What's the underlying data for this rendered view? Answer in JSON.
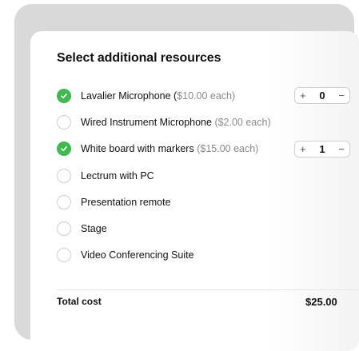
{
  "panel": {
    "title": "Select additional resources"
  },
  "resources": [
    {
      "name": "Lavalier Microphone",
      "paren_open": " (",
      "price": "$10.00 each",
      "paren_close": ")",
      "checked": true,
      "quantity": "0",
      "plus": "+",
      "minus": "−"
    },
    {
      "name": "Wired Instrument Microphone",
      "price": "($2.00 each)",
      "checked": false
    },
    {
      "name": "White board with markers",
      "price": "($15.00 each)",
      "checked": true,
      "quantity": "1",
      "plus": "+",
      "minus": "−"
    },
    {
      "name": "Lectrum with PC",
      "checked": false
    },
    {
      "name": "Presentation remote",
      "checked": false
    },
    {
      "name": "Stage",
      "checked": false
    },
    {
      "name": "Video Conferencing Suite",
      "checked": false
    }
  ],
  "summary": {
    "total_label": "Total cost",
    "total_value": "$25.00"
  },
  "colors": {
    "check_on": "#3fb950",
    "check_off_border": "#cfcfcf",
    "price_text": "#8a8a8a",
    "frame_bg": "#d9d9d9"
  },
  "icons": {
    "checked": "check-icon"
  }
}
